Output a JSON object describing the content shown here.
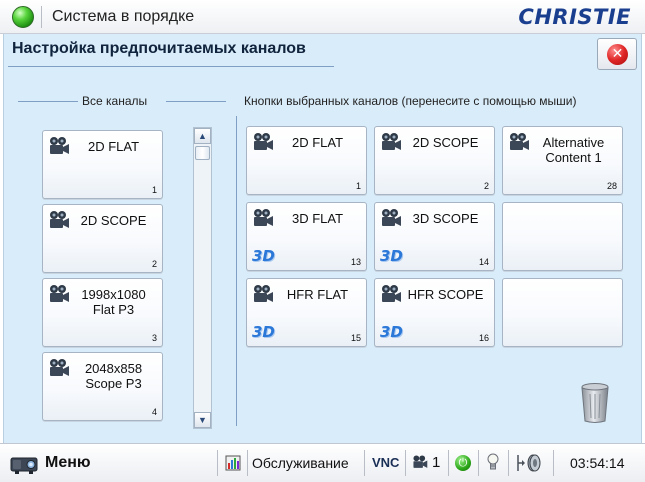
{
  "header": {
    "status_text": "Система в порядке",
    "logo_text": "CHRISTIE"
  },
  "panel": {
    "title": "Настройка предпочитаемых каналов",
    "close_label": "✕"
  },
  "all_channels": {
    "heading": "Все каналы",
    "items": [
      {
        "label": "2D FLAT",
        "number": "1"
      },
      {
        "label": "2D SCOPE",
        "number": "2"
      },
      {
        "label": "1998x1080 Flat P3",
        "number": "3"
      },
      {
        "label": "2048x858 Scope P3",
        "number": "4"
      }
    ]
  },
  "selected_channels": {
    "heading": "Кнопки выбранных каналов (перенесите с помощью мыши)",
    "badge_3d": "3D",
    "items": [
      {
        "label": "2D FLAT",
        "number": "1",
        "is3d": false
      },
      {
        "label": "2D SCOPE",
        "number": "2",
        "is3d": false
      },
      {
        "label": "Alternative Content 1",
        "number": "28",
        "is3d": false
      },
      {
        "label": "3D FLAT",
        "number": "13",
        "is3d": true
      },
      {
        "label": "3D SCOPE",
        "number": "14",
        "is3d": true
      },
      {
        "label": "",
        "number": "",
        "is3d": false
      },
      {
        "label": "HFR FLAT",
        "number": "15",
        "is3d": true
      },
      {
        "label": "HFR SCOPE",
        "number": "16",
        "is3d": true
      },
      {
        "label": "",
        "number": "",
        "is3d": false
      }
    ]
  },
  "scrollbar": {
    "up_arrow": "▲",
    "down_arrow": "▼"
  },
  "footer": {
    "menu_label": "Меню",
    "service_label": "Обслуживание",
    "vnc_label": "VNC",
    "channel_number": "1",
    "power_symbol": "⏻",
    "time": "03:54:14"
  },
  "colors": {
    "panel_background": "#d9ecf9",
    "accent_blue": "#1b3f8f",
    "status_ok": "#58d43c",
    "close_red": "#e02626",
    "badge_3d": "#2b78d8"
  },
  "icons": {
    "status": "status-led-icon",
    "close": "close-icon",
    "channel": "film-camera-icon",
    "trash": "trash-icon",
    "menu": "projector-icon",
    "service": "service-icon",
    "power": "power-icon",
    "lamp": "lamp-bulb-icon",
    "lens": "lens-icon"
  }
}
